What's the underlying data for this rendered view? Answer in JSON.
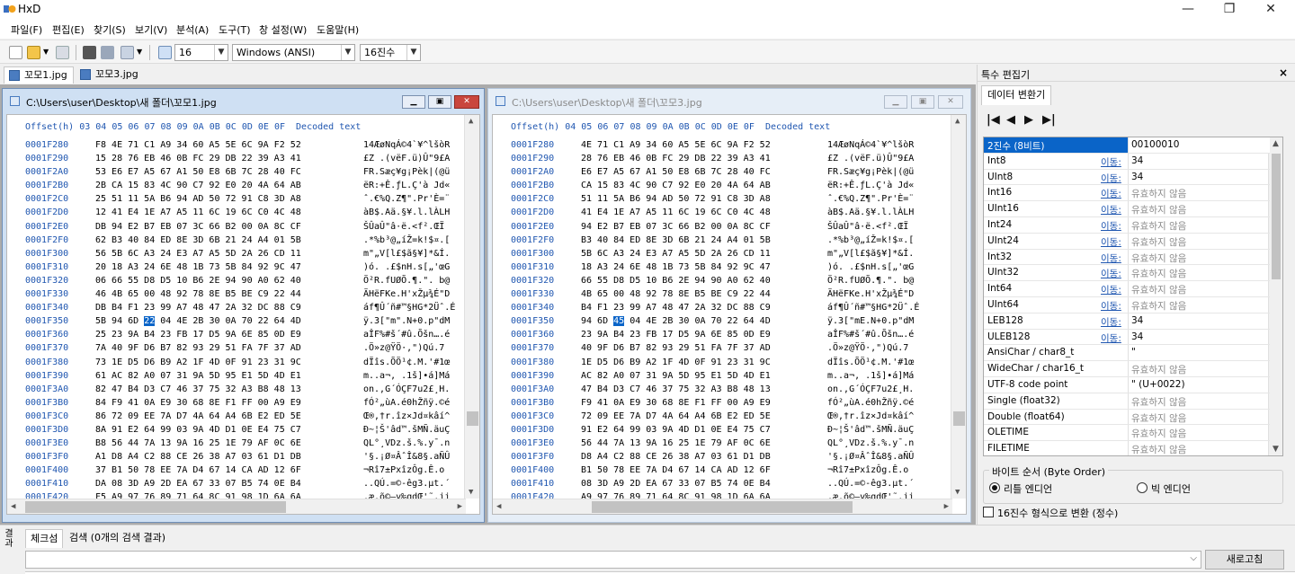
{
  "app": {
    "title": "HxD",
    "window_controls": [
      "—",
      "❐",
      "✕"
    ]
  },
  "menu": [
    "파일(F)",
    "편집(E)",
    "찾기(S)",
    "보기(V)",
    "분석(A)",
    "도구(T)",
    "창 설정(W)",
    "도움말(H)"
  ],
  "toolbar": {
    "bytes_per_row": "16",
    "charset": "Windows (ANSI)",
    "number_base": "16진수"
  },
  "file_tabs": [
    "꼬모1.jpg",
    "꼬모3.jpg"
  ],
  "editors": [
    {
      "title": "C:\\Users\\user\\Desktop\\새 폴더\\꼬모1.jpg",
      "active": true,
      "header": "Offset(h) 03 04 05 06 07 08 09 0A 0B 0C 0D 0E 0F  Decoded text",
      "selected_row": 13,
      "selected_col": 3,
      "rows": [
        {
          "offset": "0001F280",
          "hex": "F8 4E 71 C1 A9 34 60 A5 5E 6C 9A F2 52",
          "text": "14ÆøNqÁ©4`¥^lšòR"
        },
        {
          "offset": "0001F290",
          "hex": "15 28 76 EB 46 0B FC 29 DB 22 39 A3 41",
          "text": "£Z .(vëF.ü)Û\"9£A"
        },
        {
          "offset": "0001F2A0",
          "hex": "53 E6 E7 A5 67 A1 50 E8 6B 7C 28 40 FC",
          "text": "FR.Sæç¥g¡Pèk|(@ü"
        },
        {
          "offset": "0001F2B0",
          "hex": "2B CA 15 83 4C 90 C7 92 E0 20 4A 64 AB",
          "text": "ëR:+Ê.ƒL.Ç'à Jd«"
        },
        {
          "offset": "0001F2C0",
          "hex": "25 51 11 5A B6 94 AD 50 72 91 C8 3D A8",
          "text": "ˆ.€%Q.Z¶\".Pr'È=¨"
        },
        {
          "offset": "0001F2D0",
          "hex": "12 41 E4 1E A7 A5 11 6C 19 6C C0 4C 48",
          "text": "àB$.Aä.§¥.l.lÀLH"
        },
        {
          "offset": "0001F2E0",
          "hex": "DB 94 E2 B7 EB 07 3C 66 B2 00 0A 8C CF",
          "text": "ŠÛaÛ\"â·ë.<f².ŒÏ"
        },
        {
          "offset": "0001F2F0",
          "hex": "62 B3 40 84 ED 8E 3D 6B 21 24 A4 01 5B",
          "text": ".*%b³@„íŽ=k!$¤.["
        },
        {
          "offset": "0001F300",
          "hex": "56 5B 6C A3 24 E3 A7 A5 5D 2A 26 CD 11",
          "text": "m\"„V[l£$ã§¥]*&Í."
        },
        {
          "offset": "0001F310",
          "hex": "20 18 A3 24 6E 48 1B 73 5B 84 92 9C 47",
          "text": ")ó. .£$nH.s[„'œG"
        },
        {
          "offset": "0001F320",
          "hex": "06 66 55 D8 D5 10 B6 2E 94 90 A0 62 40",
          "text": "Ö²R.fUØÕ.¶.\". b@"
        },
        {
          "offset": "0001F330",
          "hex": "46 4B 65 00 48 92 78 8E B5 BE C9 22 44",
          "text": "ÄHëFKe.H'xŽµ¾É\"D"
        },
        {
          "offset": "0001F340",
          "hex": "DB B4 F1 23 99 A7 48 47 2A 32 DC 88 C9",
          "text": "áf¶Û´ñ#™§HG*2Üˆ.É"
        },
        {
          "offset": "0001F350",
          "hex": "5B 94 6D 22 04 4E 2B 30 0A 70 22 64 4D",
          "text": "ÿ.3[\"m\".N+0.p\"dM"
        },
        {
          "offset": "0001F360",
          "hex": "25 23 9A B4 23 FB 17 D5 9A 6E 85 0D E9",
          "text": "aÎF%#š´#û.Õšn….é"
        },
        {
          "offset": "0001F370",
          "hex": "7A 40 9F D6 B7 82 93 29 51 FA 7F 37 AD",
          "text": ".Ö»z@ŸÖ·‚\")Qú.7­"
        },
        {
          "offset": "0001F380",
          "hex": "73 1E D5 D6 B9 A2 1F 4D 0F 91 23 31 9C",
          "text": "dÏîs.ÕÖ¹¢.M.'#1œ"
        },
        {
          "offset": "0001F390",
          "hex": "61 AC 82 A0 07 31 9A 5D 95 E1 5D 4D E1",
          "text": "m..a¬‚ .1š]•á]Má"
        },
        {
          "offset": "0001F3A0",
          "hex": "82 47 B4 D3 C7 46 37 75 32 A3 B8 48 13",
          "text": "on.,G´ÓÇF7u2£¸H."
        },
        {
          "offset": "0001F3B0",
          "hex": "84 F9 41 0A E9 30 68 8E F1 FF 00 A9 E9",
          "text": "fÓ²„ùA.é0hŽñÿ.©é"
        },
        {
          "offset": "0001F3C0",
          "hex": "86 72 09 EE 7A D7 4A 64 A4 6B E2 ED 5E",
          "text": "Œ®,†r.îz×Jd¤kâí^"
        },
        {
          "offset": "0001F3D0",
          "hex": "8A 91 E2 64 99 03 9A 4D D1 0E E4 75 C7",
          "text": "Ð~¦Š'âd™.šMÑ.äuÇ"
        },
        {
          "offset": "0001F3E0",
          "hex": "B8 56 44 7A 13 9A 16 25 1E 79 AF 0C 6E",
          "text": "QL°¸VDz.š.%.y¯.n"
        },
        {
          "offset": "0001F3F0",
          "hex": "A1 D8 A4 C2 88 CE 26 38 A7 03 61 D1 DB",
          "text": "'§.¡Ø¤ÂˆÎ&8§.aÑÛ"
        },
        {
          "offset": "0001F400",
          "hex": "37 B1 50 78 EE 7A D4 67 14 CA AD 12 6F",
          "text": "¬Rî7±PxîzÔg.Ê­.o"
        },
        {
          "offset": "0001F410",
          "hex": "DA 08 3D A9 2D EA 67 33 07 B5 74 0E B4",
          "text": "..QÚ.=©-êg3.µt.´"
        },
        {
          "offset": "0001F420",
          "hex": "F5 A9 97 76 89 71 64 8C 91 98 1D 6A 6A",
          "text": ".æ.õ©—v‰qdŒ'˜.jj"
        }
      ]
    },
    {
      "title": "C:\\Users\\user\\Desktop\\새 폴더\\꼬모3.jpg",
      "active": false,
      "header": "Offset(h) 04 05 06 07 08 09 0A 0B 0C 0D 0E 0F  Decoded text",
      "selected_row": 13,
      "selected_col": 2,
      "rows": [
        {
          "offset": "0001F280",
          "hex": "4E 71 C1 A9 34 60 A5 5E 6C 9A F2 52",
          "text": "14ÆøNqÁ©4`¥^lšòR"
        },
        {
          "offset": "0001F290",
          "hex": "28 76 EB 46 0B FC 29 DB 22 39 A3 41",
          "text": "£Z .(vëF.ü)Û\"9£A"
        },
        {
          "offset": "0001F2A0",
          "hex": "E6 E7 A5 67 A1 50 E8 6B 7C 28 40 FC",
          "text": "FR.Sæç¥g¡Pèk|(@ü"
        },
        {
          "offset": "0001F2B0",
          "hex": "CA 15 83 4C 90 C7 92 E0 20 4A 64 AB",
          "text": "ëR:+Ê.ƒL.Ç'à Jd«"
        },
        {
          "offset": "0001F2C0",
          "hex": "51 11 5A B6 94 AD 50 72 91 C8 3D A8",
          "text": "ˆ.€%Q.Z¶\".Pr'È=¨"
        },
        {
          "offset": "0001F2D0",
          "hex": "41 E4 1E A7 A5 11 6C 19 6C C0 4C 48",
          "text": "àB$.Aä.§¥.l.lÀLH"
        },
        {
          "offset": "0001F2E0",
          "hex": "94 E2 B7 EB 07 3C 66 B2 00 0A 8C CF",
          "text": "ŠÛaÛ\"â·ë.<f².ŒÏ"
        },
        {
          "offset": "0001F2F0",
          "hex": "B3 40 84 ED 8E 3D 6B 21 24 A4 01 5B",
          "text": ".*%b³@„íŽ=k!$¤.["
        },
        {
          "offset": "0001F300",
          "hex": "5B 6C A3 24 E3 A7 A5 5D 2A 26 CD 11",
          "text": "m\"„V[l£$ã§¥]*&Í."
        },
        {
          "offset": "0001F310",
          "hex": "18 A3 24 6E 48 1B 73 5B 84 92 9C 47",
          "text": ")ó. .£$nH.s[„'œG"
        },
        {
          "offset": "0001F320",
          "hex": "66 55 D8 D5 10 B6 2E 94 90 A0 62 40",
          "text": "Ö²R.fUØÕ.¶.\". b@"
        },
        {
          "offset": "0001F330",
          "hex": "4B 65 00 48 92 78 8E B5 BE C9 22 44",
          "text": "ÄHëFKe.H'xŽµ¾É\"D"
        },
        {
          "offset": "0001F340",
          "hex": "B4 F1 23 99 A7 48 47 2A 32 DC 88 C9",
          "text": "áf¶Û´ñ#™§HG*2Üˆ.É"
        },
        {
          "offset": "0001F350",
          "hex": "94 6D 45 04 4E 2B 30 0A 70 22 64 4D",
          "text": "ÿ.3[\"mE.N+0.p\"dM"
        },
        {
          "offset": "0001F360",
          "hex": "23 9A B4 23 FB 17 D5 9A 6E 85 0D E9",
          "text": "aÎF%#š´#û.Õšn….é"
        },
        {
          "offset": "0001F370",
          "hex": "40 9F D6 B7 82 93 29 51 FA 7F 37 AD",
          "text": ".Ö»z@ŸÖ·‚\")Qú.7­"
        },
        {
          "offset": "0001F380",
          "hex": "1E D5 D6 B9 A2 1F 4D 0F 91 23 31 9C",
          "text": "dÏîs.ÕÖ¹¢.M.'#1œ"
        },
        {
          "offset": "0001F390",
          "hex": "AC 82 A0 07 31 9A 5D 95 E1 5D 4D E1",
          "text": "m..a¬‚ .1š]•á]Má"
        },
        {
          "offset": "0001F3A0",
          "hex": "47 B4 D3 C7 46 37 75 32 A3 B8 48 13",
          "text": "on.,G´ÓÇF7u2£¸H."
        },
        {
          "offset": "0001F3B0",
          "hex": "F9 41 0A E9 30 68 8E F1 FF 00 A9 E9",
          "text": "fÓ²„ùA.é0hŽñÿ.©é"
        },
        {
          "offset": "0001F3C0",
          "hex": "72 09 EE 7A D7 4A 64 A4 6B E2 ED 5E",
          "text": "Œ®,†r.îz×Jd¤kâí^"
        },
        {
          "offset": "0001F3D0",
          "hex": "91 E2 64 99 03 9A 4D D1 0E E4 75 C7",
          "text": "Ð~¦Š'âd™.šMÑ.äuÇ"
        },
        {
          "offset": "0001F3E0",
          "hex": "56 44 7A 13 9A 16 25 1E 79 AF 0C 6E",
          "text": "QL°¸VDz.š.%.y¯.n"
        },
        {
          "offset": "0001F3F0",
          "hex": "D8 A4 C2 88 CE 26 38 A7 03 61 D1 DB",
          "text": "'§.¡Ø¤ÂˆÎ&8§.aÑÛ"
        },
        {
          "offset": "0001F400",
          "hex": "B1 50 78 EE 7A D4 67 14 CA AD 12 6F",
          "text": "¬Rî7±PxîzÔg.Ê­.o"
        },
        {
          "offset": "0001F410",
          "hex": "08 3D A9 2D EA 67 33 07 B5 74 0E B4",
          "text": "..QÚ.=©-êg3.µt.´"
        },
        {
          "offset": "0001F420",
          "hex": "A9 97 76 89 71 64 8C 91 98 1D 6A 6A",
          "text": ".æ.õ©—v‰qdŒ'˜.jj"
        }
      ]
    }
  ],
  "panel": {
    "title": "특수 편집기",
    "close": "×",
    "tab": "데이터 변환기",
    "nav": [
      "|◀",
      "◀",
      "▶",
      "▶|"
    ],
    "rows": [
      {
        "name": "2진수 (8비트)",
        "link": "",
        "value": "00100010",
        "grey": false,
        "selected": true
      },
      {
        "name": "Int8",
        "link": "이동:",
        "value": "34",
        "grey": false
      },
      {
        "name": "UInt8",
        "link": "이동:",
        "value": "34",
        "grey": false
      },
      {
        "name": "Int16",
        "link": "이동:",
        "value": "유효하지 않음",
        "grey": true
      },
      {
        "name": "UInt16",
        "link": "이동:",
        "value": "유효하지 않음",
        "grey": true
      },
      {
        "name": "Int24",
        "link": "이동:",
        "value": "유효하지 않음",
        "grey": true
      },
      {
        "name": "UInt24",
        "link": "이동:",
        "value": "유효하지 않음",
        "grey": true
      },
      {
        "name": "Int32",
        "link": "이동:",
        "value": "유효하지 않음",
        "grey": true
      },
      {
        "name": "UInt32",
        "link": "이동:",
        "value": "유효하지 않음",
        "grey": true
      },
      {
        "name": "Int64",
        "link": "이동:",
        "value": "유효하지 않음",
        "grey": true
      },
      {
        "name": "UInt64",
        "link": "이동:",
        "value": "유효하지 않음",
        "grey": true
      },
      {
        "name": "LEB128",
        "link": "이동:",
        "value": "34",
        "grey": false
      },
      {
        "name": "ULEB128",
        "link": "이동:",
        "value": "34",
        "grey": false
      },
      {
        "name": "AnsiChar / char8_t",
        "link": "",
        "value": "\"",
        "grey": false
      },
      {
        "name": "WideChar / char16_t",
        "link": "",
        "value": "유효하지 않음",
        "grey": true
      },
      {
        "name": "UTF-8 code point",
        "link": "",
        "value": "\" (U+0022)",
        "grey": false
      },
      {
        "name": "Single (float32)",
        "link": "",
        "value": "유효하지 않음",
        "grey": true
      },
      {
        "name": "Double (float64)",
        "link": "",
        "value": "유효하지 않음",
        "grey": true
      },
      {
        "name": "OLETIME",
        "link": "",
        "value": "유효하지 않음",
        "grey": true
      },
      {
        "name": "FILETIME",
        "link": "",
        "value": "유효하지 않음",
        "grey": true
      }
    ],
    "byte_order_label": "바이트 순서 (Byte Order)",
    "little_endian": "리틀 엔디언",
    "big_endian": "빅 엔디언",
    "hex_checkbox": "16진수 형식으로 변환 (정수)"
  },
  "bottom": {
    "vertical_label": "결과",
    "tabs": [
      "체크섬",
      "검색 (0개의 검색 결과)"
    ],
    "refresh": "새로고침"
  },
  "colors": {
    "selection": "#0a64c8",
    "offset_blue": "#1f56b0",
    "close_red": "#c9463d"
  }
}
